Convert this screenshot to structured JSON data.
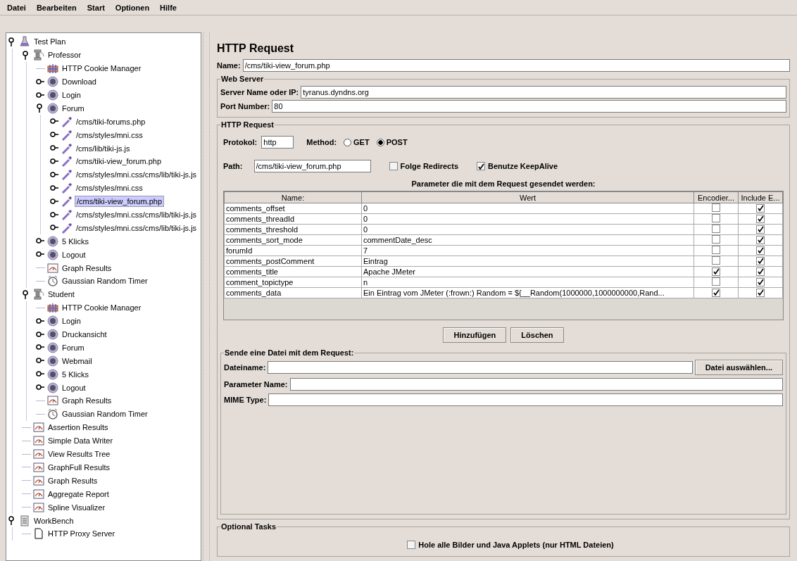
{
  "menu": [
    "Datei",
    "Bearbeiten",
    "Start",
    "Optionen",
    "Hilfe"
  ],
  "tree": [
    {
      "label": "Test Plan",
      "kind": "plan",
      "expanded": true,
      "selected": false,
      "children": [
        {
          "label": "Professor",
          "kind": "group",
          "expanded": true,
          "selected": false,
          "children": [
            {
              "label": "HTTP Cookie Manager",
              "kind": "config",
              "selected": false
            },
            {
              "label": "Download",
              "kind": "controller",
              "expanded": false,
              "selected": false
            },
            {
              "label": "Login",
              "kind": "controller",
              "expanded": false,
              "selected": false
            },
            {
              "label": "Forum",
              "kind": "controller",
              "expanded": true,
              "selected": false,
              "children": [
                {
                  "label": "/cms/tiki-forums.php",
                  "kind": "sampler",
                  "expanded": false,
                  "selected": false
                },
                {
                  "label": "/cms/styles/mni.css",
                  "kind": "sampler",
                  "expanded": false,
                  "selected": false
                },
                {
                  "label": "/cms/lib/tiki-js.js",
                  "kind": "sampler",
                  "expanded": false,
                  "selected": false
                },
                {
                  "label": "/cms/tiki-view_forum.php",
                  "kind": "sampler",
                  "expanded": false,
                  "selected": false
                },
                {
                  "label": "/cms/styles/mni.css/cms/lib/tiki-js.js",
                  "kind": "sampler",
                  "expanded": false,
                  "selected": false
                },
                {
                  "label": "/cms/styles/mni.css",
                  "kind": "sampler",
                  "expanded": false,
                  "selected": false
                },
                {
                  "label": "/cms/tiki-view_forum.php",
                  "kind": "sampler",
                  "expanded": false,
                  "selected": true
                },
                {
                  "label": "/cms/styles/mni.css/cms/lib/tiki-js.js",
                  "kind": "sampler",
                  "expanded": false,
                  "selected": false
                },
                {
                  "label": "/cms/styles/mni.css/cms/lib/tiki-js.js",
                  "kind": "sampler",
                  "expanded": false,
                  "selected": false
                }
              ]
            },
            {
              "label": "5 Klicks",
              "kind": "controller",
              "expanded": false,
              "selected": false
            },
            {
              "label": "Logout",
              "kind": "controller",
              "expanded": false,
              "selected": false
            },
            {
              "label": "Graph Results",
              "kind": "listener",
              "selected": false
            },
            {
              "label": "Gaussian Random Timer",
              "kind": "timer",
              "selected": false
            }
          ]
        },
        {
          "label": "Student",
          "kind": "group",
          "expanded": true,
          "selected": false,
          "children": [
            {
              "label": "HTTP Cookie Manager",
              "kind": "config",
              "selected": false
            },
            {
              "label": "Login",
              "kind": "controller",
              "expanded": false,
              "selected": false
            },
            {
              "label": "Druckansicht",
              "kind": "controller",
              "expanded": false,
              "selected": false
            },
            {
              "label": "Forum",
              "kind": "controller",
              "expanded": false,
              "selected": false
            },
            {
              "label": "Webmail",
              "kind": "controller",
              "expanded": false,
              "selected": false
            },
            {
              "label": "5 Klicks",
              "kind": "controller",
              "expanded": false,
              "selected": false
            },
            {
              "label": "Logout",
              "kind": "controller",
              "expanded": false,
              "selected": false
            },
            {
              "label": "Graph Results",
              "kind": "listener",
              "selected": false
            },
            {
              "label": "Gaussian Random Timer",
              "kind": "timer",
              "selected": false
            }
          ]
        },
        {
          "label": "Assertion Results",
          "kind": "listener",
          "selected": false
        },
        {
          "label": "Simple Data Writer",
          "kind": "listener",
          "selected": false
        },
        {
          "label": "View Results Tree",
          "kind": "listener",
          "selected": false
        },
        {
          "label": "GraphFull Results",
          "kind": "listener",
          "selected": false
        },
        {
          "label": "Graph Results",
          "kind": "listener",
          "selected": false
        },
        {
          "label": "Aggregate Report",
          "kind": "listener",
          "selected": false
        },
        {
          "label": "Spline Visualizer",
          "kind": "listener",
          "selected": false
        }
      ]
    },
    {
      "label": "WorkBench",
      "kind": "workbench",
      "expanded": true,
      "selected": false,
      "children": [
        {
          "label": "HTTP Proxy Server",
          "kind": "page",
          "selected": false
        }
      ]
    }
  ],
  "panel": {
    "title": "HTTP Request",
    "name_label": "Name:",
    "name_value": "/cms/tiki-view_forum.php",
    "web_server": {
      "legend": "Web Server",
      "server_label": "Server Name oder IP:",
      "server_value": "tyranus.dyndns.org",
      "port_label": "Port Number:",
      "port_value": "80"
    },
    "http_request": {
      "legend": "HTTP Request",
      "protocol_label": "Protokol:",
      "protocol_value": "http",
      "method_label": "Method:",
      "methods": [
        {
          "label": "GET",
          "selected": false
        },
        {
          "label": "POST",
          "selected": true
        }
      ],
      "path_label": "Path:",
      "path_value": "/cms/tiki-view_forum.php",
      "options": [
        {
          "label": "Folge Redirects",
          "checked": false
        },
        {
          "label": "Benutze KeepAlive",
          "checked": true
        }
      ],
      "params_title": "Parameter die mit dem Request gesendet werden:",
      "columns": [
        "Name:",
        "Wert",
        "Encodier...",
        "Include E..."
      ],
      "rows": [
        {
          "name": "comments_offset",
          "value": "0",
          "encode": false,
          "include": true
        },
        {
          "name": "comments_threadId",
          "value": "0",
          "encode": false,
          "include": true
        },
        {
          "name": "comments_threshold",
          "value": "0",
          "encode": false,
          "include": true
        },
        {
          "name": "comments_sort_mode",
          "value": "commentDate_desc",
          "encode": false,
          "include": true
        },
        {
          "name": "forumId",
          "value": "7",
          "encode": false,
          "include": true
        },
        {
          "name": "comments_postComment",
          "value": "Eintrag",
          "encode": false,
          "include": true
        },
        {
          "name": "comments_title",
          "value": "Apache JMeter",
          "encode": true,
          "include": true
        },
        {
          "name": "comment_topictype",
          "value": "n",
          "encode": false,
          "include": true
        },
        {
          "name": "comments_data",
          "value": "Ein Eintrag vom JMeter (:frown:) Random =  ${__Random(1000000,1000000000,Rand...",
          "encode": true,
          "include": true
        }
      ],
      "buttons": [
        "Hinzufügen",
        "Löschen"
      ],
      "file": {
        "legend": "Sende eine Datei mit dem Request:",
        "filename_label": "Dateiname:",
        "browse_button": "Datei auswählen...",
        "param_label": "Parameter Name:",
        "mime_label": "MIME Type:"
      }
    },
    "optional": {
      "legend": "Optional Tasks",
      "option": {
        "label": "Hole alle Bilder und Java Applets (nur HTML Dateien)",
        "checked": false
      }
    }
  }
}
